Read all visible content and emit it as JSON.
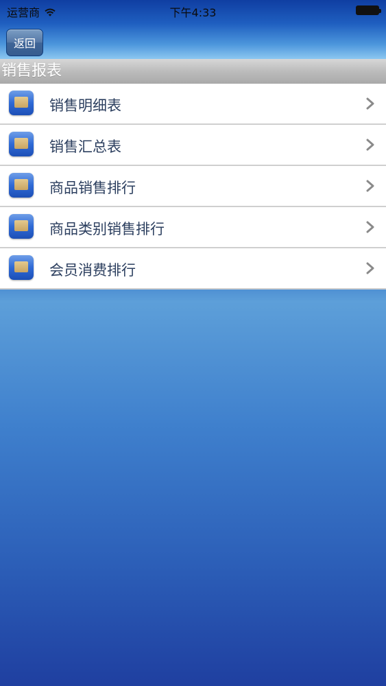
{
  "status_bar": {
    "carrier": "运营商",
    "time": "下午4:33"
  },
  "nav": {
    "back_label": "返回"
  },
  "section": {
    "title": "销售报表"
  },
  "menu": {
    "items": [
      {
        "label": "销售明细表"
      },
      {
        "label": "销售汇总表"
      },
      {
        "label": "商品销售排行"
      },
      {
        "label": "商品类别销售排行"
      },
      {
        "label": "会员消费排行"
      }
    ]
  }
}
